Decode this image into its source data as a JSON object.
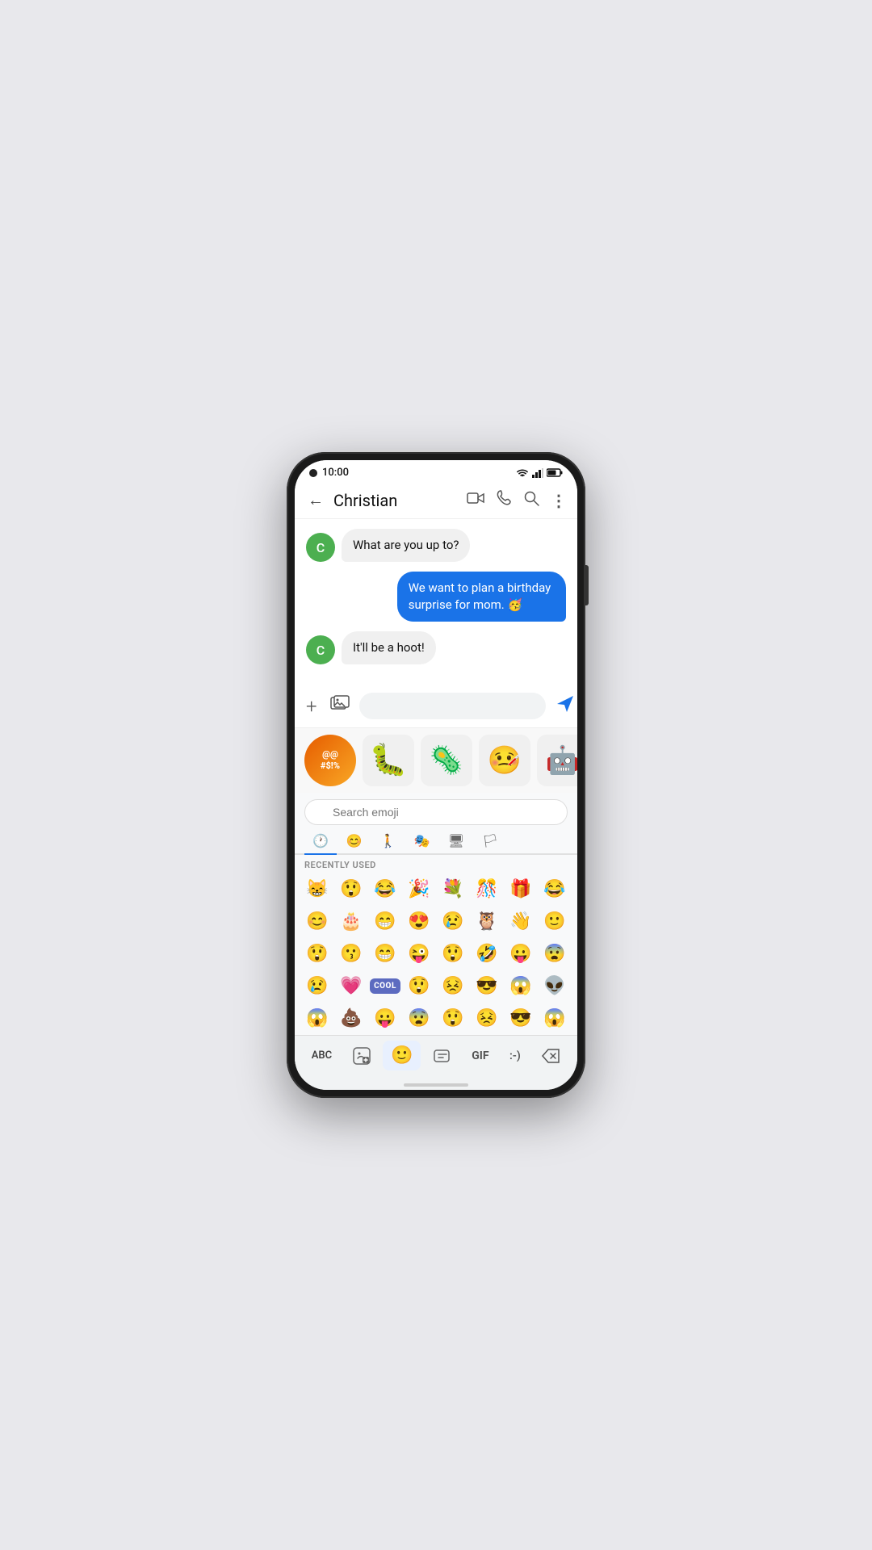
{
  "statusBar": {
    "time": "10:00",
    "wifiIcon": "▲",
    "signalIcon": "◀",
    "batteryIcon": "▮"
  },
  "header": {
    "backLabel": "←",
    "contactName": "Christian",
    "videoCallIcon": "⬛",
    "phoneIcon": "📞",
    "searchIcon": "🔍",
    "moreIcon": "⋮"
  },
  "messages": [
    {
      "id": 1,
      "type": "incoming",
      "avatar": "C",
      "text": "What are you up to?"
    },
    {
      "id": 2,
      "type": "outgoing",
      "text": "We want to plan a birthday surprise for mom. 🥳"
    },
    {
      "id": 3,
      "type": "incoming",
      "avatar": "C",
      "text": "It'll be a hoot!"
    }
  ],
  "inputArea": {
    "addIcon": "+",
    "galleryIcon": "🖼",
    "placeholder": "",
    "sendIcon": "➤"
  },
  "stickers": [
    {
      "id": 1,
      "emoji": "@@ #$!%",
      "type": "cursing"
    },
    {
      "id": 2,
      "emoji": "🐛",
      "type": "blob"
    },
    {
      "id": 3,
      "emoji": "🦠",
      "type": "germ"
    },
    {
      "id": 4,
      "emoji": "🤒",
      "type": "sick"
    },
    {
      "id": 5,
      "emoji": "🤖",
      "type": "robot"
    }
  ],
  "emojiSearch": {
    "placeholder": "Search emoji"
  },
  "emojiTabs": [
    {
      "id": "recent",
      "icon": "🕐",
      "active": true
    },
    {
      "id": "smileys",
      "icon": "😊",
      "active": false
    },
    {
      "id": "people",
      "icon": "🚶",
      "active": false
    },
    {
      "id": "activities",
      "icon": "🎭",
      "active": false
    },
    {
      "id": "objects",
      "icon": "🖥",
      "active": false
    },
    {
      "id": "flags",
      "icon": "🏳",
      "active": false
    }
  ],
  "recentlyUsed": {
    "label": "RECENTLY USED",
    "emojis": [
      "😸",
      "😲",
      "😂",
      "🎉",
      "💐",
      "🎊",
      "🎁",
      "😂",
      "😊",
      "🎂",
      "😁",
      "😍",
      "😢",
      "🦉",
      "👋",
      "🙂",
      "😲",
      "😗",
      "😁",
      "😜",
      "😲",
      "🤣",
      "😛",
      "😨",
      "😢",
      "💗",
      "🆒",
      "😲",
      "😣",
      "😎",
      "😱",
      "👽",
      "😱",
      "💩",
      "😛",
      "😨"
    ]
  },
  "keyboardBottom": {
    "abcLabel": "ABC",
    "stickerLabel": "",
    "emojiLabel": "",
    "stickersLabel": "",
    "gifLabel": "GIF",
    "emoticonsLabel": ":-)",
    "backspaceLabel": "⌫"
  }
}
